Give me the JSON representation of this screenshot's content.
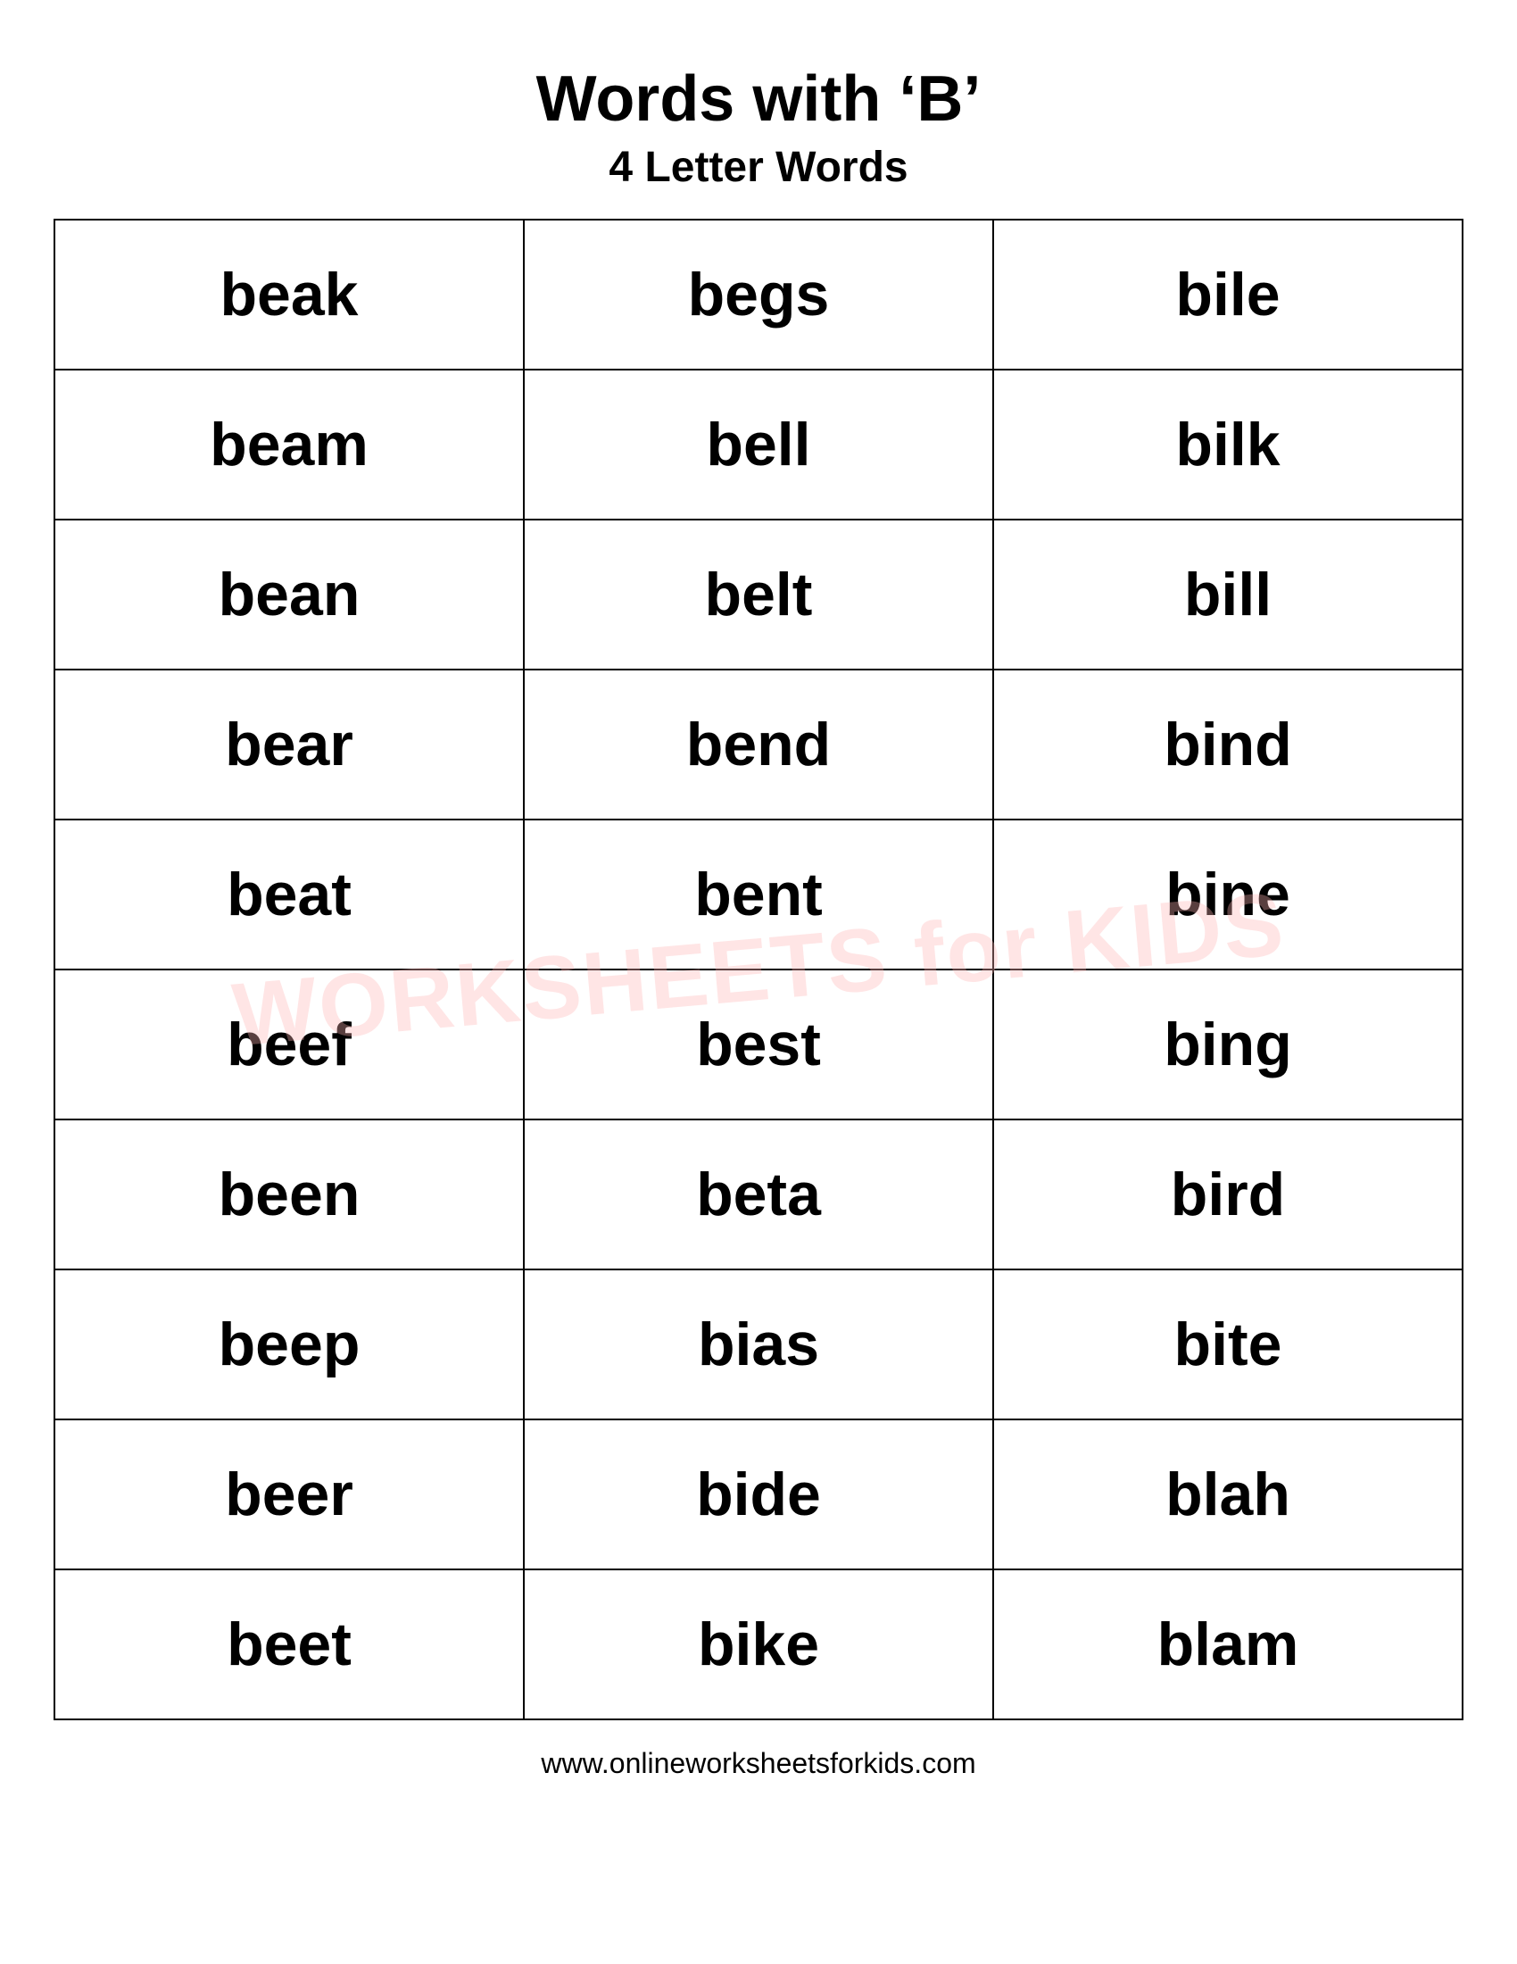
{
  "header": {
    "title": "Words with ‘B’",
    "subtitle": "4 Letter Words"
  },
  "table": {
    "rows": [
      [
        "beak",
        "begs",
        "bile"
      ],
      [
        "beam",
        "bell",
        "bilk"
      ],
      [
        "bean",
        "belt",
        "bill"
      ],
      [
        "bear",
        "bend",
        "bind"
      ],
      [
        "beat",
        "bent",
        "bine"
      ],
      [
        "beef",
        "best",
        "bing"
      ],
      [
        "been",
        "beta",
        "bird"
      ],
      [
        "beep",
        "bias",
        "bite"
      ],
      [
        "beer",
        "bide",
        "blah"
      ],
      [
        "beet",
        "bike",
        "blam"
      ]
    ]
  },
  "watermark": {
    "line1": "WORKSHEETS for KIDS"
  },
  "footer": {
    "url": "www.onlineworksheetsforkids.com"
  }
}
